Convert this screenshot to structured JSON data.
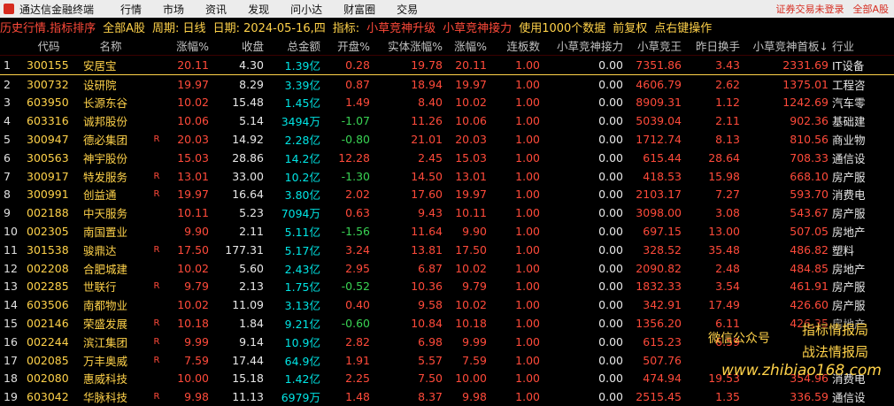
{
  "app": {
    "title": "通达信金融终端",
    "menu": [
      "行情",
      "市场",
      "资讯",
      "发现",
      "问小达",
      "财富圈",
      "交易"
    ],
    "right": [
      "证券交易未登录",
      "全部A股"
    ]
  },
  "info": {
    "mode": "历史行情.指标排序",
    "scope": "全部A股",
    "period": "周期: 日线",
    "date": "日期: 2024-05-16,四",
    "indicator_label": "指标:",
    "indicator1": "小草竞神升级",
    "indicator2": "小草竞神接力",
    "usage": "使用1000个数据",
    "adjust": "前复权",
    "hint": "点右键操作"
  },
  "columns": [
    "",
    "代码",
    "名称",
    "",
    "涨幅%",
    "收盘",
    "总金额",
    "开盘%",
    "实体涨幅%",
    "涨幅%",
    "连板数",
    "小草竞神接力",
    "小草竞王",
    "昨日换手",
    "小草竞神首板↓",
    "行业"
  ],
  "rows": [
    {
      "i": "1",
      "code": "300155",
      "name": "安居宝",
      "r": "",
      "zf": "20.11",
      "close": "4.30",
      "amt": "1.39亿",
      "open": "0.28",
      "real": "19.78",
      "zf2": "20.11",
      "lb": "1.00",
      "jsl": "0.00",
      "kw": "7351.86",
      "hs": "3.43",
      "sb": "2331.69",
      "ind": "IT设备"
    },
    {
      "i": "2",
      "code": "300732",
      "name": "设研院",
      "r": "",
      "zf": "19.97",
      "close": "8.29",
      "amt": "3.39亿",
      "open": "0.87",
      "real": "18.94",
      "zf2": "19.97",
      "lb": "1.00",
      "jsl": "0.00",
      "kw": "4606.79",
      "hs": "2.62",
      "sb": "1375.01",
      "ind": "工程咨"
    },
    {
      "i": "3",
      "code": "603950",
      "name": "长源东谷",
      "r": "",
      "zf": "10.02",
      "close": "15.48",
      "amt": "1.45亿",
      "open": "1.49",
      "real": "8.40",
      "zf2": "10.02",
      "lb": "1.00",
      "jsl": "0.00",
      "kw": "8909.31",
      "hs": "1.12",
      "sb": "1242.69",
      "ind": "汽车零"
    },
    {
      "i": "4",
      "code": "603316",
      "name": "诚邦股份",
      "r": "",
      "zf": "10.06",
      "close": "5.14",
      "amt": "3494万",
      "open": "-1.07",
      "real": "11.26",
      "zf2": "10.06",
      "lb": "1.00",
      "jsl": "0.00",
      "kw": "5039.04",
      "hs": "2.11",
      "sb": "902.36",
      "ind": "基础建"
    },
    {
      "i": "5",
      "code": "300947",
      "name": "德必集团",
      "r": "R",
      "zf": "20.03",
      "close": "14.92",
      "amt": "2.28亿",
      "open": "-0.80",
      "real": "21.01",
      "zf2": "20.03",
      "lb": "1.00",
      "jsl": "0.00",
      "kw": "1712.74",
      "hs": "8.13",
      "sb": "810.56",
      "ind": "商业物"
    },
    {
      "i": "6",
      "code": "300563",
      "name": "神宇股份",
      "r": "",
      "zf": "15.03",
      "close": "28.86",
      "amt": "14.2亿",
      "open": "12.28",
      "real": "2.45",
      "zf2": "15.03",
      "lb": "1.00",
      "jsl": "0.00",
      "kw": "615.44",
      "hs": "28.64",
      "sb": "708.33",
      "ind": "通信设"
    },
    {
      "i": "7",
      "code": "300917",
      "name": "特发服务",
      "r": "R",
      "zf": "13.01",
      "close": "33.00",
      "amt": "10.2亿",
      "open": "-1.30",
      "real": "14.50",
      "zf2": "13.01",
      "lb": "1.00",
      "jsl": "0.00",
      "kw": "418.53",
      "hs": "15.98",
      "sb": "668.10",
      "ind": "房产服"
    },
    {
      "i": "8",
      "code": "300991",
      "name": "创益通",
      "r": "R",
      "zf": "19.97",
      "close": "16.64",
      "amt": "3.80亿",
      "open": "2.02",
      "real": "17.60",
      "zf2": "19.97",
      "lb": "1.00",
      "jsl": "0.00",
      "kw": "2103.17",
      "hs": "7.27",
      "sb": "593.70",
      "ind": "消费电"
    },
    {
      "i": "9",
      "code": "002188",
      "name": "中天服务",
      "r": "",
      "zf": "10.11",
      "close": "5.23",
      "amt": "7094万",
      "open": "0.63",
      "real": "9.43",
      "zf2": "10.11",
      "lb": "1.00",
      "jsl": "0.00",
      "kw": "3098.00",
      "hs": "3.08",
      "sb": "543.67",
      "ind": "房产服"
    },
    {
      "i": "10",
      "code": "002305",
      "name": "南国置业",
      "r": "",
      "zf": "9.90",
      "close": "2.11",
      "amt": "5.11亿",
      "open": "-1.56",
      "real": "11.64",
      "zf2": "9.90",
      "lb": "1.00",
      "jsl": "0.00",
      "kw": "697.15",
      "hs": "13.00",
      "sb": "507.05",
      "ind": "房地产"
    },
    {
      "i": "11",
      "code": "301538",
      "name": "骏鼎达",
      "r": "R",
      "zf": "17.50",
      "close": "177.31",
      "amt": "5.17亿",
      "open": "3.24",
      "real": "13.81",
      "zf2": "17.50",
      "lb": "1.00",
      "jsl": "0.00",
      "kw": "328.52",
      "hs": "35.48",
      "sb": "486.82",
      "ind": "塑料"
    },
    {
      "i": "12",
      "code": "002208",
      "name": "合肥城建",
      "r": "",
      "zf": "10.02",
      "close": "5.60",
      "amt": "2.43亿",
      "open": "2.95",
      "real": "6.87",
      "zf2": "10.02",
      "lb": "1.00",
      "jsl": "0.00",
      "kw": "2090.82",
      "hs": "2.48",
      "sb": "484.85",
      "ind": "房地产"
    },
    {
      "i": "13",
      "code": "002285",
      "name": "世联行",
      "r": "R",
      "zf": "9.79",
      "close": "2.13",
      "amt": "1.75亿",
      "open": "-0.52",
      "real": "10.36",
      "zf2": "9.79",
      "lb": "1.00",
      "jsl": "0.00",
      "kw": "1832.33",
      "hs": "3.54",
      "sb": "461.91",
      "ind": "房产服"
    },
    {
      "i": "14",
      "code": "603506",
      "name": "南都物业",
      "r": "",
      "zf": "10.02",
      "close": "11.09",
      "amt": "3.13亿",
      "open": "0.40",
      "real": "9.58",
      "zf2": "10.02",
      "lb": "1.00",
      "jsl": "0.00",
      "kw": "342.91",
      "hs": "17.49",
      "sb": "426.60",
      "ind": "房产服"
    },
    {
      "i": "15",
      "code": "002146",
      "name": "荣盛发展",
      "r": "R",
      "zf": "10.18",
      "close": "1.84",
      "amt": "9.21亿",
      "open": "-0.60",
      "real": "10.84",
      "zf2": "10.18",
      "lb": "1.00",
      "jsl": "0.00",
      "kw": "1356.20",
      "hs": "6.11",
      "sb": "426.35",
      "ind": "房地产"
    },
    {
      "i": "16",
      "code": "002244",
      "name": "滨江集团",
      "r": "R",
      "zf": "9.99",
      "close": "9.14",
      "amt": "10.9亿",
      "open": "2.82",
      "real": "6.98",
      "zf2": "9.99",
      "lb": "1.00",
      "jsl": "0.00",
      "kw": "615.23",
      "hs": "6.59",
      "sb": "",
      "ind": ""
    },
    {
      "i": "17",
      "code": "002085",
      "name": "万丰奥威",
      "r": "R",
      "zf": "7.59",
      "close": "17.44",
      "amt": "64.9亿",
      "open": "1.91",
      "real": "5.57",
      "zf2": "7.59",
      "lb": "1.00",
      "jsl": "0.00",
      "kw": "507.76",
      "hs": "",
      "sb": "",
      "ind": ""
    },
    {
      "i": "18",
      "code": "002080",
      "name": "惠威科技",
      "r": "",
      "zf": "10.00",
      "close": "15.18",
      "amt": "1.42亿",
      "open": "2.25",
      "real": "7.50",
      "zf2": "10.00",
      "lb": "1.00",
      "jsl": "0.00",
      "kw": "474.94",
      "hs": "19.53",
      "sb": "354.96",
      "ind": "消费电"
    },
    {
      "i": "19",
      "code": "603042",
      "name": "华脉科技",
      "r": "R",
      "zf": "9.98",
      "close": "11.13",
      "amt": "6979万",
      "open": "1.48",
      "real": "8.37",
      "zf2": "9.98",
      "lb": "1.00",
      "jsl": "0.00",
      "kw": "2515.45",
      "hs": "1.35",
      "sb": "336.59",
      "ind": "通信设"
    }
  ],
  "watermark": {
    "wechat": "微信公众号",
    "tag1": "指标情报局",
    "tag2": "战法情报局",
    "site": "www.zhibiao168.com"
  }
}
